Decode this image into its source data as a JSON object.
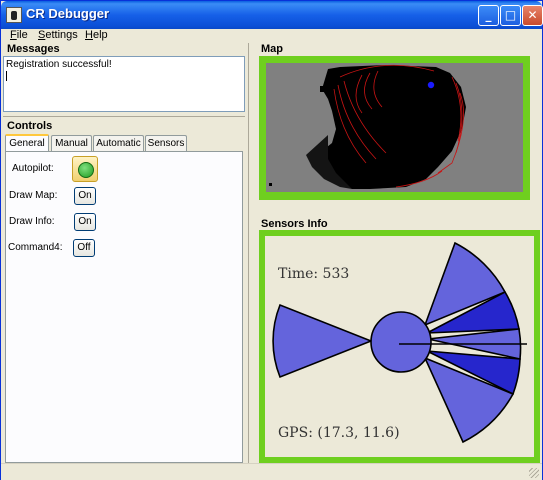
{
  "window": {
    "title": "CR Debugger",
    "buttons": {
      "minimize": "_",
      "maximize": "□",
      "close": "✕"
    }
  },
  "menu": {
    "items": [
      {
        "label": "File",
        "underline": "F",
        "rest": "ile"
      },
      {
        "label": "Settings",
        "underline": "S",
        "rest": "ettings"
      },
      {
        "label": "Help",
        "underline": "H",
        "rest": "elp"
      }
    ]
  },
  "messages": {
    "title": "Messages",
    "text": "Registration successful!"
  },
  "controls": {
    "title": "Controls",
    "tabs": [
      "General",
      "Manual",
      "Automatic",
      "Sensors"
    ],
    "active_tab": "General",
    "rows": [
      {
        "label": "Autopilot:",
        "state": "on-indicator"
      },
      {
        "label": "Draw Map:",
        "value": "On"
      },
      {
        "label": "Draw Info:",
        "value": "On"
      },
      {
        "label": "Command4:",
        "value": "Off"
      }
    ]
  },
  "map": {
    "title": "Map",
    "robot_color": "#1a1aff",
    "background_color": "#808080",
    "frame_color": "#6fcf1f"
  },
  "sensors": {
    "title": "Sensors Info",
    "time_text": "Time: 533",
    "gps_text": "GPS: (17.3, 11.6)",
    "sector_color": "#6464dc",
    "sector_dark_color": "#2626cc"
  }
}
